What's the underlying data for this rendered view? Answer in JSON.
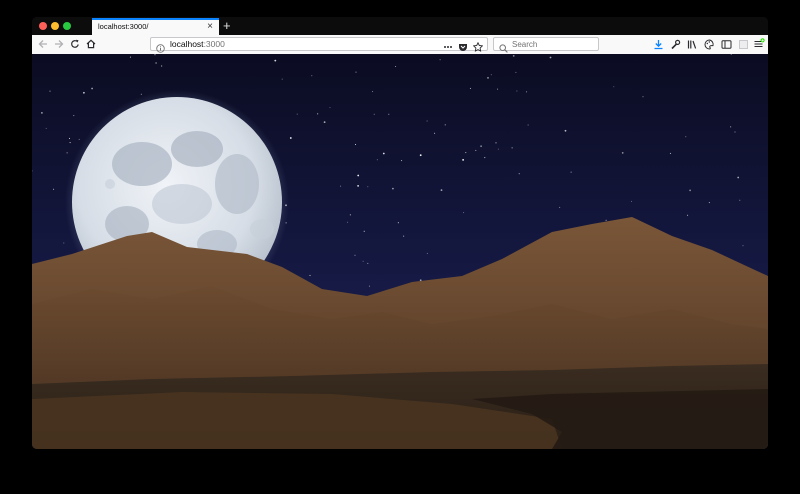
{
  "browser": {
    "tab": {
      "title": "localhost:3000/"
    },
    "urlbar": {
      "host": "localhost",
      "port": ":3000"
    },
    "search": {
      "placeholder": "Search"
    }
  },
  "icons": {
    "window_controls": [
      "close-traffic-light",
      "minimize-traffic-light",
      "maximize-traffic-light"
    ],
    "navigation": [
      "back-arrow-icon",
      "forward-arrow-icon",
      "reload-icon",
      "home-icon"
    ],
    "urlbar": [
      "info-icon",
      "page-actions-icon",
      "pocket-icon",
      "bookmark-star-icon"
    ],
    "toolbar": [
      "downloads-icon",
      "wrench-icon",
      "library-icon",
      "theme-icon",
      "sidebar-icon",
      "screenshot-icon",
      "hamburger-menu-icon"
    ]
  },
  "colors": {
    "tab_accent": "#0a84ff",
    "chrome_dark": "#0c0c0d",
    "toolbar_light": "#f9f9fa",
    "sky_top": "#0b0c22",
    "sky_bottom": "#1c2150",
    "mountain": "#6a4a2f",
    "moon": "#dde3ea"
  }
}
